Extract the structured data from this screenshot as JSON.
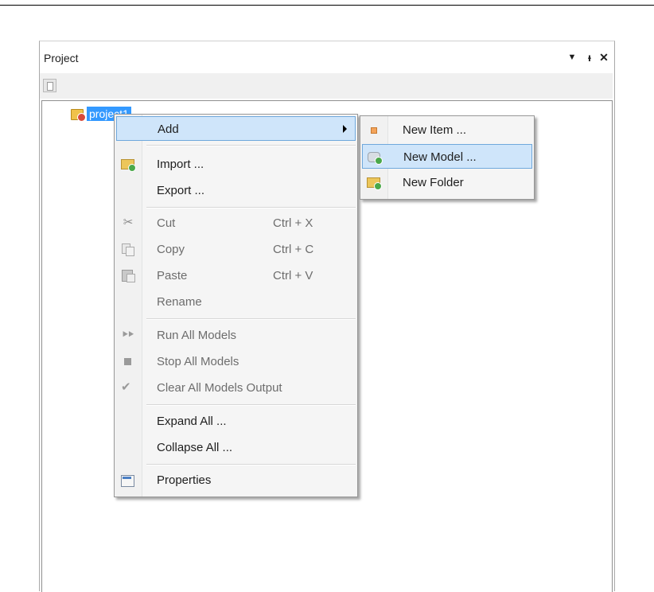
{
  "panel": {
    "title": "Project",
    "header_buttons": [
      {
        "name": "dropdown-arrow-icon",
        "glyph": "▼"
      },
      {
        "name": "pin-icon",
        "glyph": "ᵼ"
      },
      {
        "name": "close-icon",
        "glyph": "✕"
      }
    ]
  },
  "tree": {
    "root_label": "project1"
  },
  "context_menu": {
    "add": "Add",
    "import": "Import ...",
    "export": "Export ...",
    "cut": "Cut",
    "cut_shortcut": "Ctrl + X",
    "copy": "Copy",
    "copy_shortcut": "Ctrl + C",
    "paste": "Paste",
    "paste_shortcut": "Ctrl + V",
    "rename": "Rename",
    "run_all": "Run All Models",
    "stop_all": "Stop All Models",
    "clear_all": "Clear All Models Output",
    "expand_all": "Expand All ...",
    "collapse_all": "Collapse All ...",
    "properties": "Properties"
  },
  "submenu": {
    "new_item": "New Item ...",
    "new_model": "New Model ...",
    "new_folder": "New Folder"
  },
  "icons": {
    "cut": "✂",
    "run": "⯈⯈",
    "clear": "✔"
  },
  "colors": {
    "selection": "#3399ff",
    "hover_bg": "#cfe5fa",
    "hover_border": "#6fa8dc"
  }
}
